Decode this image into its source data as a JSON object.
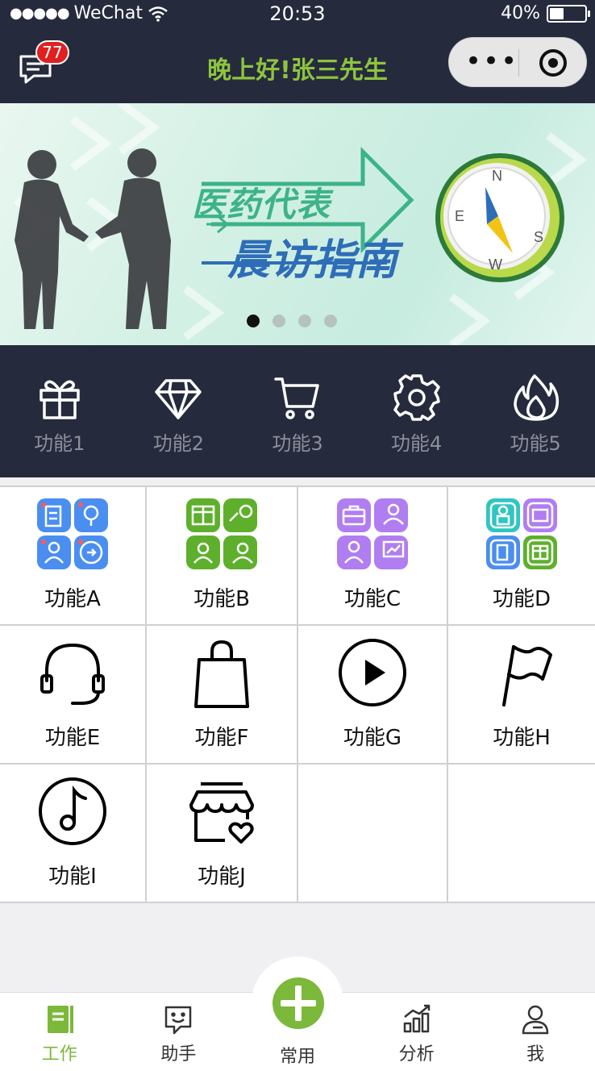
{
  "status_bar": {
    "carrier": "WeChat",
    "time": "20:53",
    "battery": "40%",
    "battery_level": 0.4
  },
  "header": {
    "title": "晚上好!张三先生",
    "badge": "77"
  },
  "banner": {
    "line1": "医药代表",
    "line2": "晨访指南",
    "compass": [
      "N",
      "E",
      "S",
      "W"
    ],
    "slides": 4,
    "active_slide": 0
  },
  "quick": [
    {
      "label": "功能1",
      "icon": "gift-icon"
    },
    {
      "label": "功能2",
      "icon": "diamond-icon"
    },
    {
      "label": "功能3",
      "icon": "cart-icon"
    },
    {
      "label": "功能4",
      "icon": "gear-icon"
    },
    {
      "label": "功能5",
      "icon": "flame-icon"
    }
  ],
  "grid": [
    {
      "label": "功能A",
      "icon": "blue-tiles-icon"
    },
    {
      "label": "功能B",
      "icon": "green-tiles-icon"
    },
    {
      "label": "功能C",
      "icon": "purple-tiles-icon"
    },
    {
      "label": "功能D",
      "icon": "multicolor-tiles-icon"
    },
    {
      "label": "功能E",
      "icon": "headset-icon"
    },
    {
      "label": "功能F",
      "icon": "shopping-bag-icon"
    },
    {
      "label": "功能G",
      "icon": "play-icon"
    },
    {
      "label": "功能H",
      "icon": "flag-icon"
    },
    {
      "label": "功能I",
      "icon": "music-note-icon"
    },
    {
      "label": "功能J",
      "icon": "store-heart-icon"
    }
  ],
  "tabbar": [
    {
      "label": "工作",
      "icon": "notebook-icon",
      "active": true
    },
    {
      "label": "助手",
      "icon": "chat-smile-icon"
    },
    {
      "label": "常用",
      "icon": "plus-icon"
    },
    {
      "label": "分析",
      "icon": "bar-chart-icon"
    },
    {
      "label": "我",
      "icon": "user-icon"
    }
  ],
  "colors": {
    "dark": "#262a3d",
    "accent": "#7cb83a",
    "title": "#8cc43f",
    "badge": "#e02020"
  }
}
